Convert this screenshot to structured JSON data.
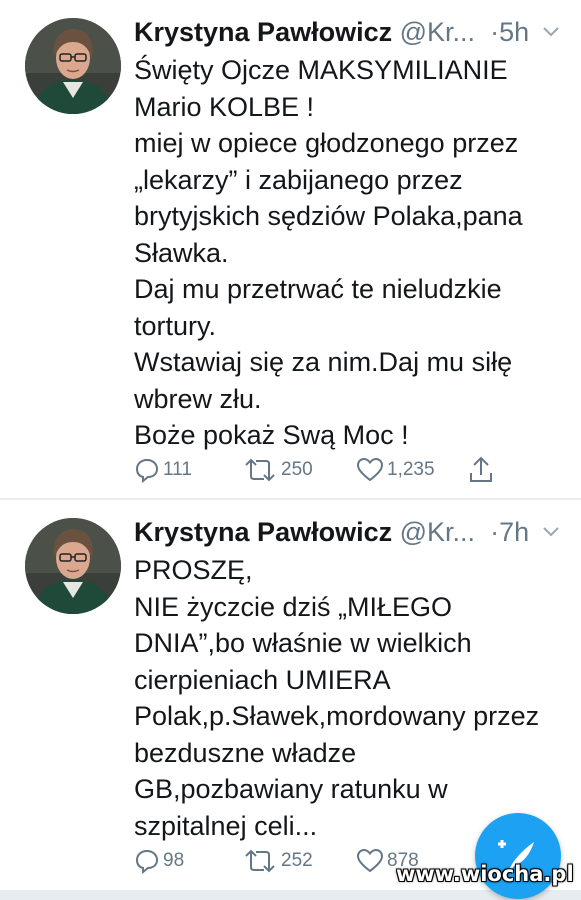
{
  "tweets": [
    {
      "name": "Krystyna Pawłowicz",
      "handle": "@Kr...",
      "time": "5h",
      "lines": [
        "Święty Ojcze MAKSYMILIANIE",
        "Mario KOLBE !",
        "miej w opiece głodzonego przez",
        "„lekarzy” i zabijanego przez",
        "brytyjskich sędziów Polaka,pana",
        "Sławka.",
        "Daj mu przetrwać te nieludzkie",
        "tortury.",
        "Wstawiaj się za nim.Daj mu siłę",
        "wbrew złu.",
        "Boże pokaż Swą Moc !"
      ],
      "replies": "111",
      "retweets": "250",
      "likes": "1,235"
    },
    {
      "name": "Krystyna Pawłowicz",
      "handle": "@Kr...",
      "time": "7h",
      "lines": [
        "PROSZĘ,",
        "NIE życzcie dziś „MIŁEGO",
        "DNIA”,bo właśnie w wielkich",
        "cierpieniach UMIERA",
        "Polak,p.Sławek,mordowany przez",
        "bezduszne władze",
        "GB,pozbawiany ratunku w",
        "szpitalnej celi..."
      ],
      "replies": "98",
      "retweets": "252",
      "likes": "878"
    }
  ],
  "icons": {
    "reply": "reply-icon",
    "retweet": "retweet-icon",
    "like": "heart-icon",
    "share": "share-icon",
    "more": "chevron-down-icon",
    "compose": "compose-tweet-icon"
  },
  "colors": {
    "accent": "#1da1f2",
    "muted": "#657786",
    "text": "#14171a",
    "divider": "#e6ecf0"
  },
  "watermark": "www.wiocha.pl"
}
